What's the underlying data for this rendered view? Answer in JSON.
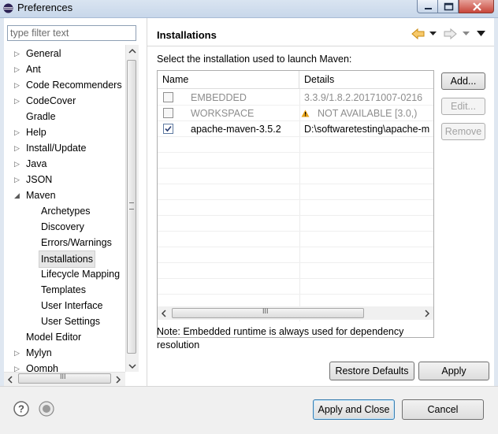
{
  "window": {
    "title": "Preferences"
  },
  "filter": {
    "placeholder": "type filter text"
  },
  "tree": {
    "items": [
      {
        "label": "General",
        "level": 0,
        "twisty": "collapsed"
      },
      {
        "label": "Ant",
        "level": 0,
        "twisty": "collapsed"
      },
      {
        "label": "Code Recommenders",
        "level": 0,
        "twisty": "collapsed"
      },
      {
        "label": "CodeCover",
        "level": 0,
        "twisty": "collapsed"
      },
      {
        "label": "Gradle",
        "level": 0,
        "twisty": "none"
      },
      {
        "label": "Help",
        "level": 0,
        "twisty": "collapsed"
      },
      {
        "label": "Install/Update",
        "level": 0,
        "twisty": "collapsed"
      },
      {
        "label": "Java",
        "level": 0,
        "twisty": "collapsed"
      },
      {
        "label": "JSON",
        "level": 0,
        "twisty": "collapsed"
      },
      {
        "label": "Maven",
        "level": 0,
        "twisty": "expanded"
      },
      {
        "label": "Archetypes",
        "level": 1,
        "twisty": "none"
      },
      {
        "label": "Discovery",
        "level": 1,
        "twisty": "none"
      },
      {
        "label": "Errors/Warnings",
        "level": 1,
        "twisty": "none"
      },
      {
        "label": "Installations",
        "level": 1,
        "twisty": "none",
        "selected": true
      },
      {
        "label": "Lifecycle Mapping",
        "level": 1,
        "twisty": "none"
      },
      {
        "label": "Templates",
        "level": 1,
        "twisty": "none"
      },
      {
        "label": "User Interface",
        "level": 1,
        "twisty": "none"
      },
      {
        "label": "User Settings",
        "level": 1,
        "twisty": "none"
      },
      {
        "label": "Model Editor",
        "level": 0,
        "twisty": "none"
      },
      {
        "label": "Mylyn",
        "level": 0,
        "twisty": "collapsed"
      },
      {
        "label": "Oomph",
        "level": 0,
        "twisty": "collapsed"
      }
    ]
  },
  "page": {
    "title": "Installations",
    "description": "Select the installation used to launch Maven:",
    "note": "Note: Embedded runtime is always used for dependency resolution"
  },
  "table": {
    "columns": [
      "Name",
      "Details"
    ],
    "rows": [
      {
        "checked": false,
        "name": "EMBEDDED",
        "details": "3.3.9/1.8.2.20171007-0216",
        "dimmed": true,
        "warning": false
      },
      {
        "checked": false,
        "name": "WORKSPACE",
        "details": "NOT AVAILABLE [3.0,)",
        "dimmed": true,
        "warning": true
      },
      {
        "checked": true,
        "name": "apache-maven-3.5.2",
        "details": "D:\\softwaretesting\\apache-m",
        "dimmed": false,
        "warning": false
      }
    ],
    "scroll_grip": "III"
  },
  "buttons": {
    "add": "Add...",
    "edit": "Edit...",
    "remove": "Remove",
    "restore_defaults": "Restore Defaults",
    "apply": "Apply",
    "apply_and_close": "Apply and Close",
    "cancel": "Cancel"
  },
  "left_scroll_grip": "III",
  "icons": {
    "help": "help-icon",
    "import_export": "import-export-icon",
    "back": "back-arrow-icon",
    "forward": "forward-arrow-icon",
    "view_menu": "view-menu-icon",
    "warning": "warning-icon"
  },
  "colors": {
    "back_arrow": "#e8a317",
    "warning": "#e8a317",
    "dimmed_text": "#8d8d8d"
  }
}
